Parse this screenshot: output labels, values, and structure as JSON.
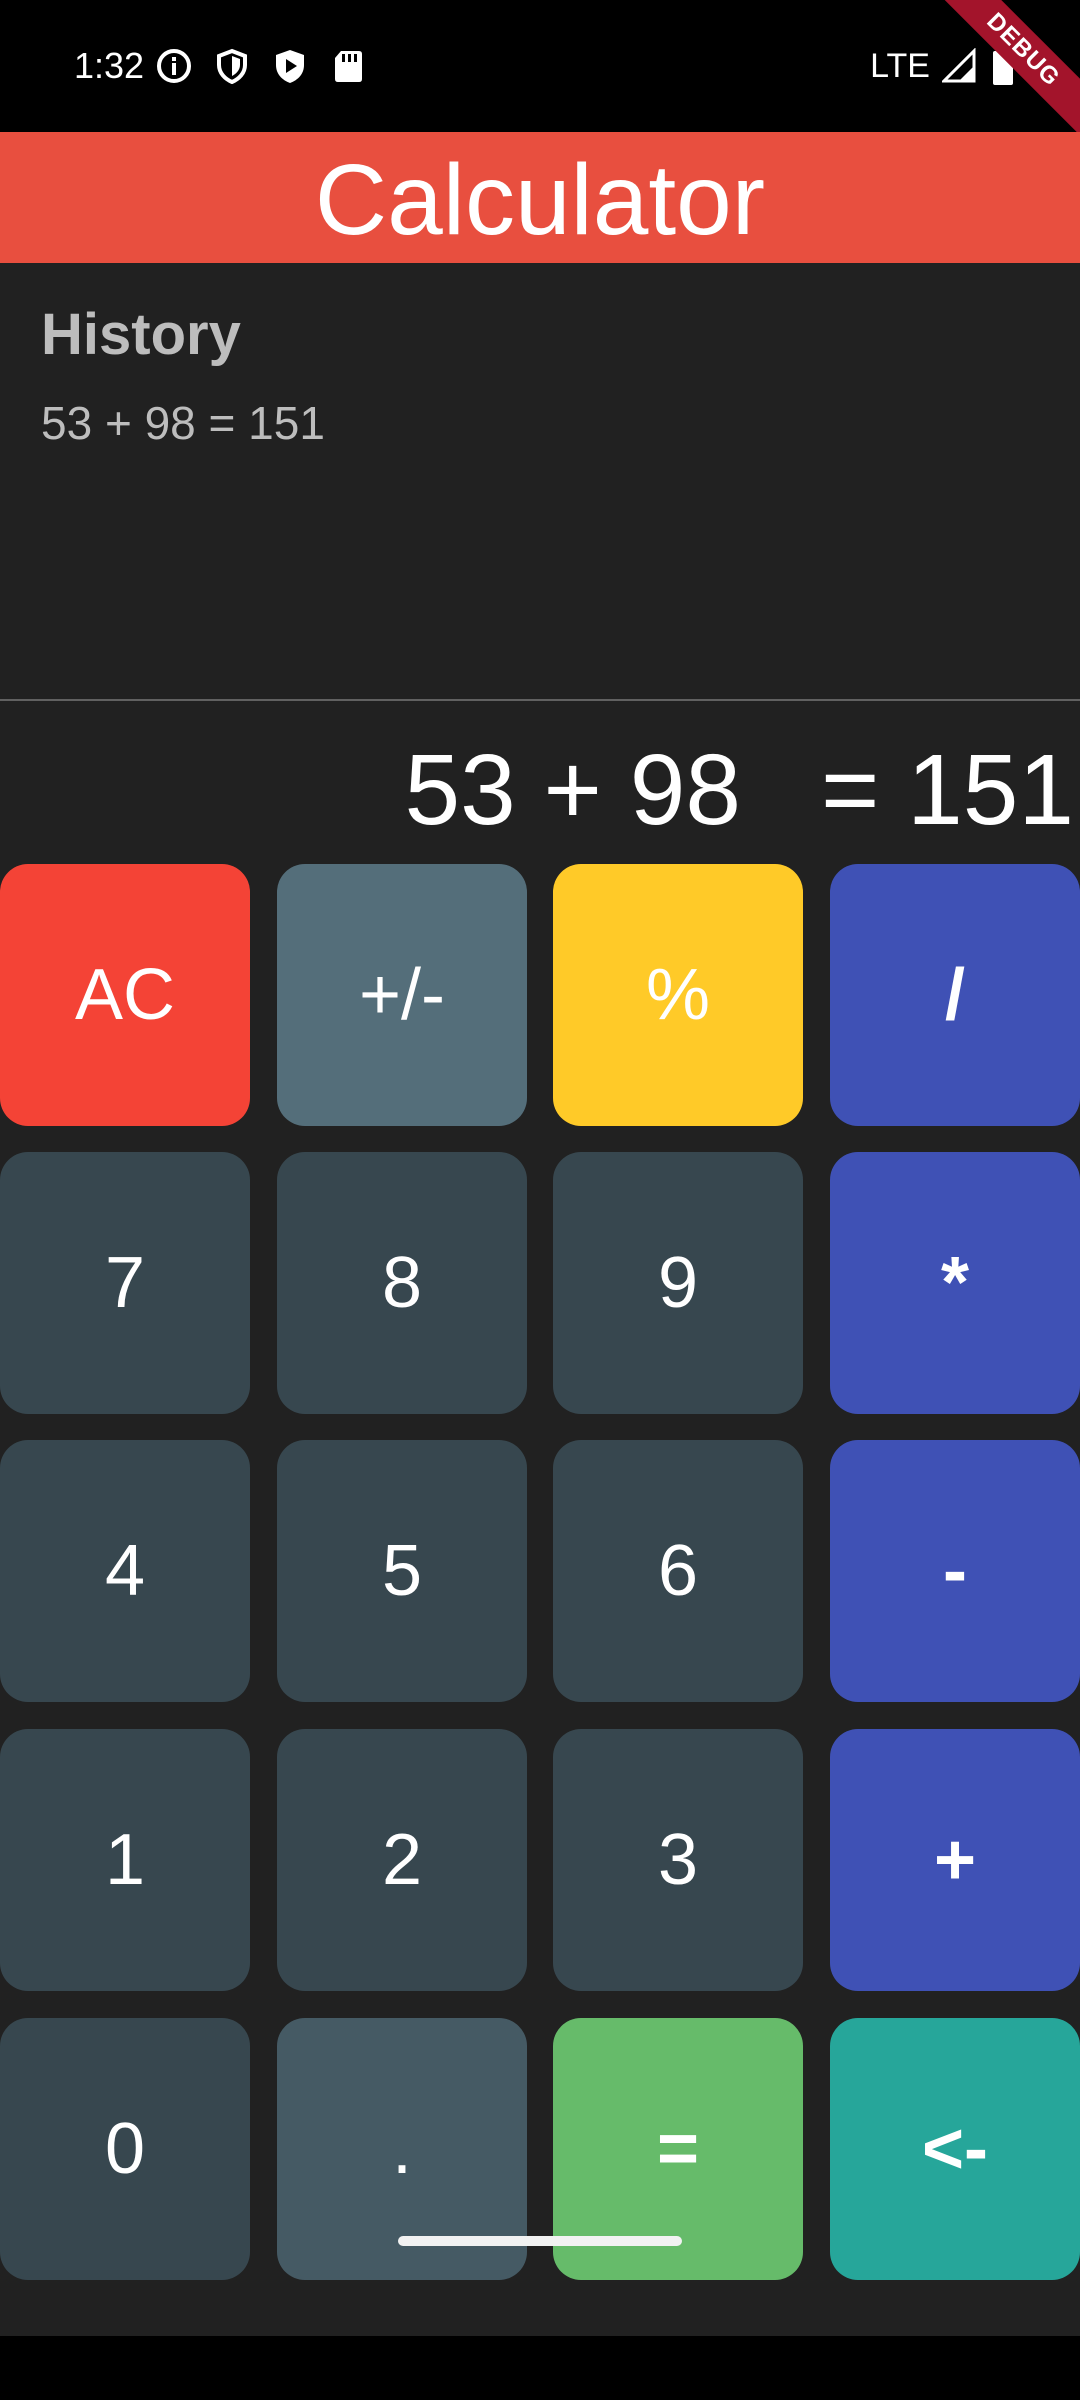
{
  "status_bar": {
    "time": "1:32",
    "network": "LTE",
    "debug_label": "DEBUG",
    "icons": [
      "info-icon",
      "shield-icon",
      "play-protect-icon",
      "sd-card-icon",
      "signal-icon",
      "battery-icon"
    ]
  },
  "app_bar": {
    "title": "Calculator",
    "color": "#e84f3f"
  },
  "history": {
    "title": "History",
    "entries": [
      "53 + 98 = 151"
    ]
  },
  "display": {
    "expression": "53 + 98",
    "result": "= 151"
  },
  "keypad": {
    "rows": [
      [
        {
          "label": "AC",
          "color": "#f44336"
        },
        {
          "label": "+/-",
          "color": "#546e7a"
        },
        {
          "label": "%",
          "color": "#ffca28"
        },
        {
          "label": "/",
          "color": "#3f51b5"
        }
      ],
      [
        {
          "label": "7",
          "color": "#37474f"
        },
        {
          "label": "8",
          "color": "#37474f"
        },
        {
          "label": "9",
          "color": "#37474f"
        },
        {
          "label": "*",
          "color": "#3f51b5"
        }
      ],
      [
        {
          "label": "4",
          "color": "#37474f"
        },
        {
          "label": "5",
          "color": "#37474f"
        },
        {
          "label": "6",
          "color": "#37474f"
        },
        {
          "label": "-",
          "color": "#3f51b5"
        }
      ],
      [
        {
          "label": "1",
          "color": "#37474f"
        },
        {
          "label": "2",
          "color": "#37474f"
        },
        {
          "label": "3",
          "color": "#37474f"
        },
        {
          "label": "+",
          "color": "#3f51b5"
        }
      ],
      [
        {
          "label": "0",
          "color": "#37474f"
        },
        {
          "label": ".",
          "color": "#455a64"
        },
        {
          "label": "=",
          "color": "#66bb6a"
        },
        {
          "label": "<-",
          "color": "#26a69a"
        }
      ]
    ]
  }
}
